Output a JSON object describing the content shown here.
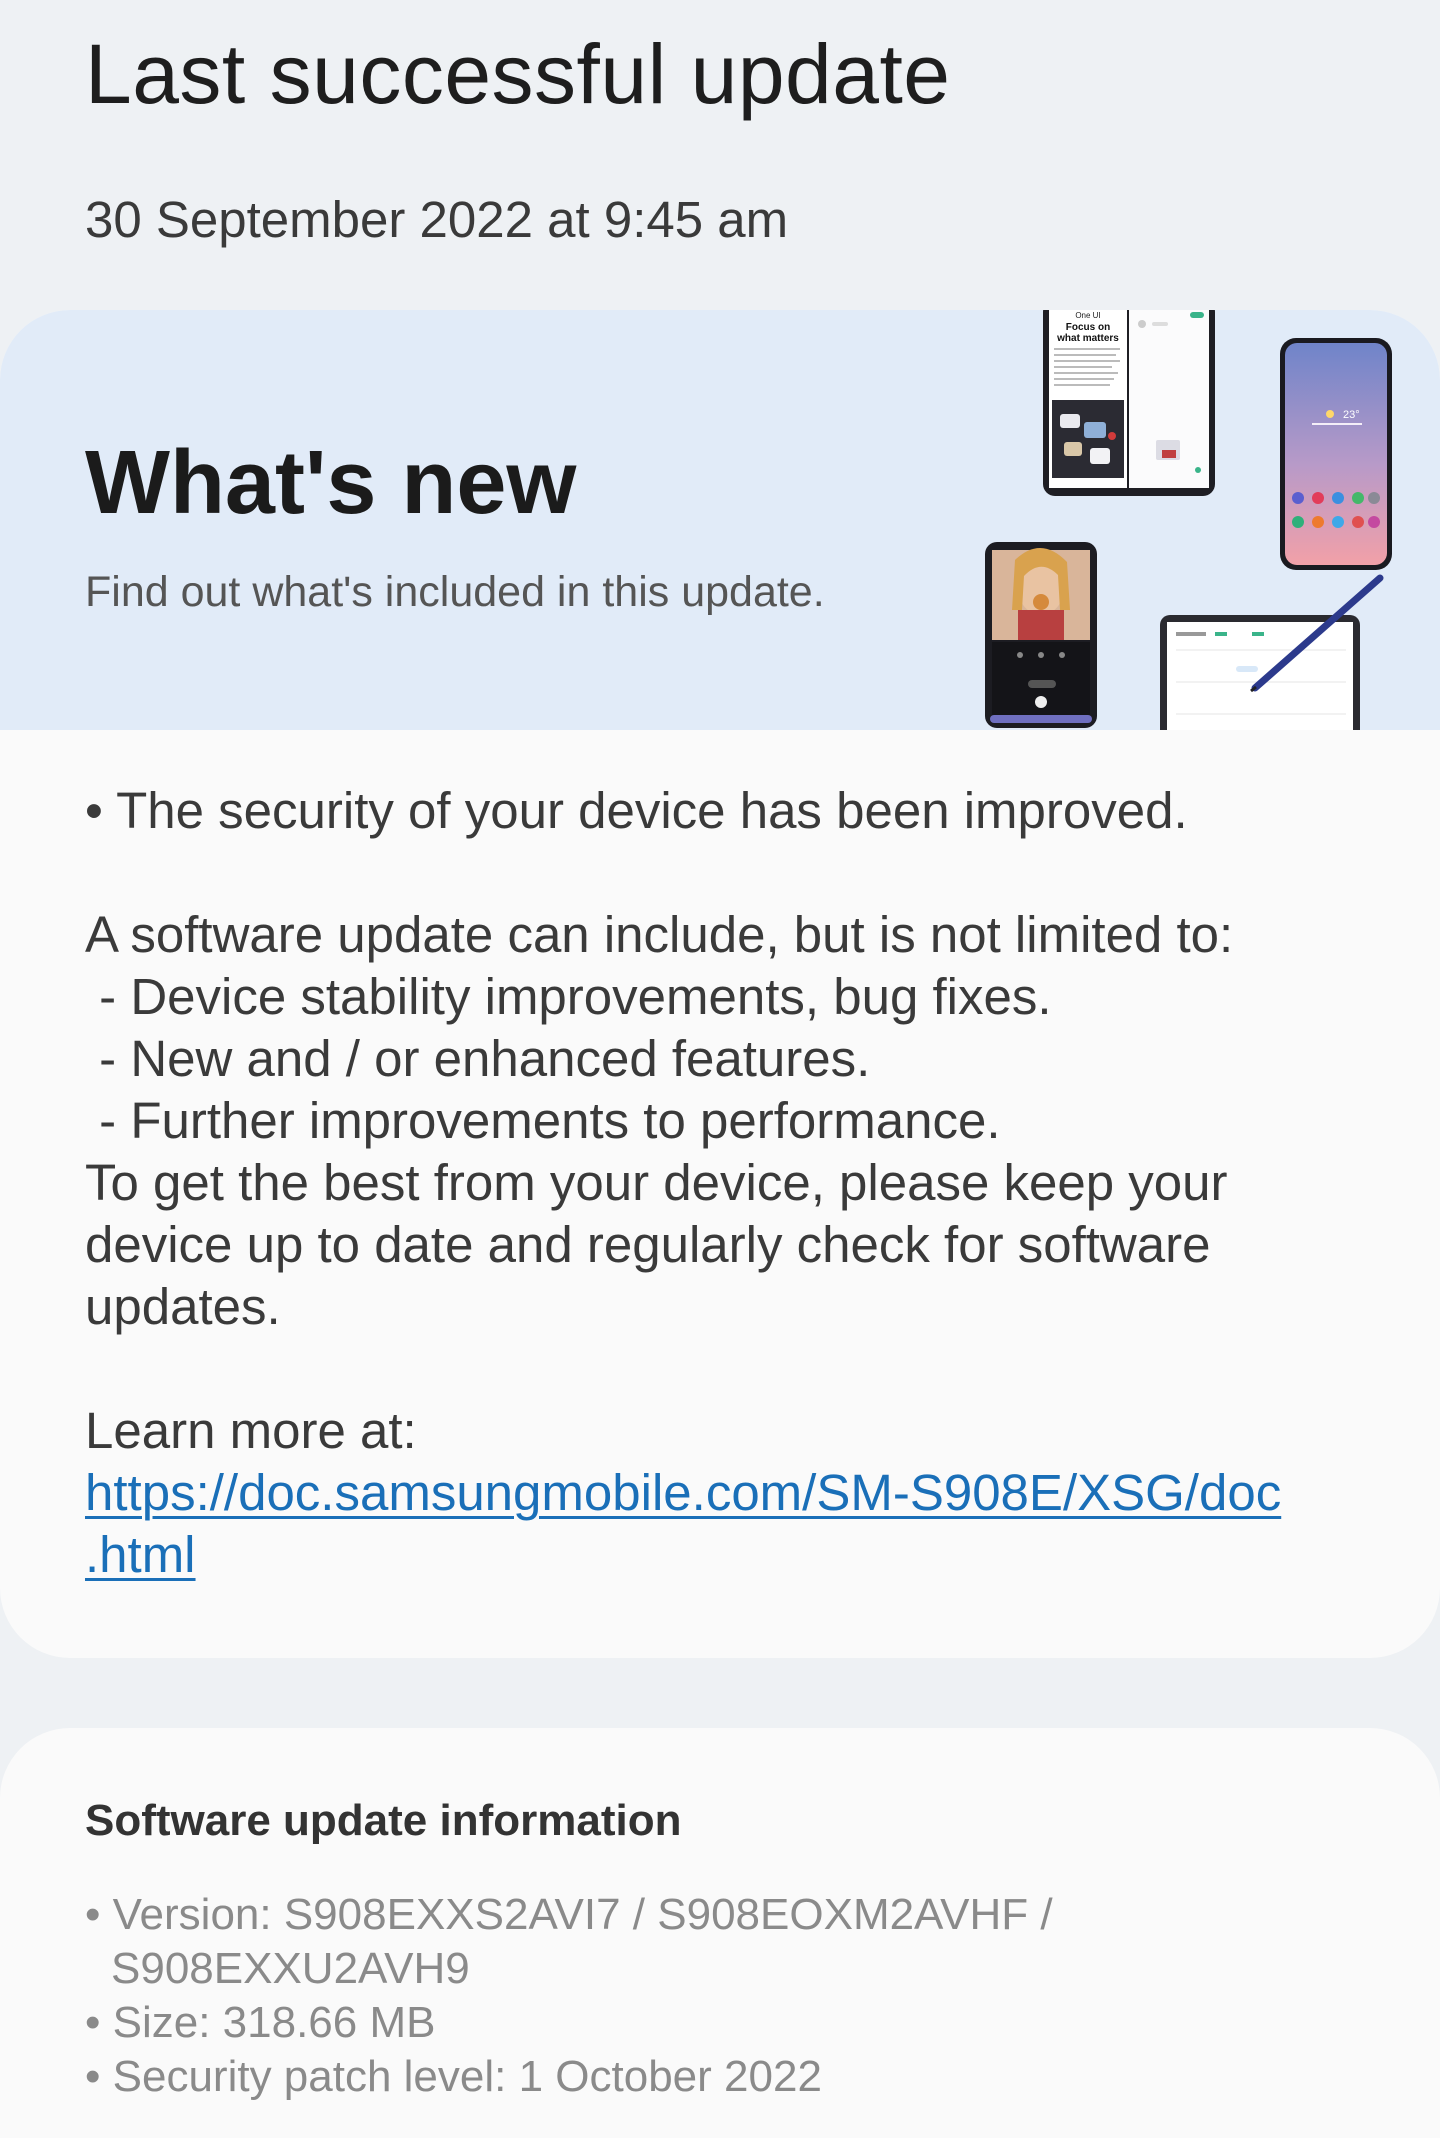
{
  "header": {
    "title": "Last successful update",
    "date": "30 September 2022 at 9:45 am"
  },
  "whats_new": {
    "title": "What's new",
    "subtitle": "Find out what's included in this update.",
    "banner_texts": {
      "foldable_brand": "One UI",
      "foldable_headline_1": "Focus on",
      "foldable_headline_2": "what matters",
      "weather_temp": "23°"
    },
    "security_bullet": "• The security of your device has been improved.",
    "intro": "A software update can include, but is not limited to:",
    "list_items": [
      " - Device stability improvements, bug fixes.",
      " - New and / or enhanced features.",
      " - Further improvements to performance."
    ],
    "keep_lines": [
      "To get the best from your device, please keep your",
      "device up to date and regularly check for software",
      "updates."
    ],
    "learn_more": "Learn more at:",
    "link_lines": [
      "https://doc.samsungmobile.com/SM-S908E/XSG/doc",
      ".html"
    ]
  },
  "software_info": {
    "heading": "Software update information",
    "version_line_1": "• Version: S908EXXS2AVI7 / S908EOXM2AVHF /",
    "version_line_2": "S908EXXU2AVH9",
    "size": "• Size: 318.66 MB",
    "security_patch": "• Security patch level: 1 October 2022"
  },
  "colors": {
    "background": "#eef1f4",
    "banner": "#e1ebf8",
    "card": "#fafafa",
    "link": "#1a6fb8"
  }
}
